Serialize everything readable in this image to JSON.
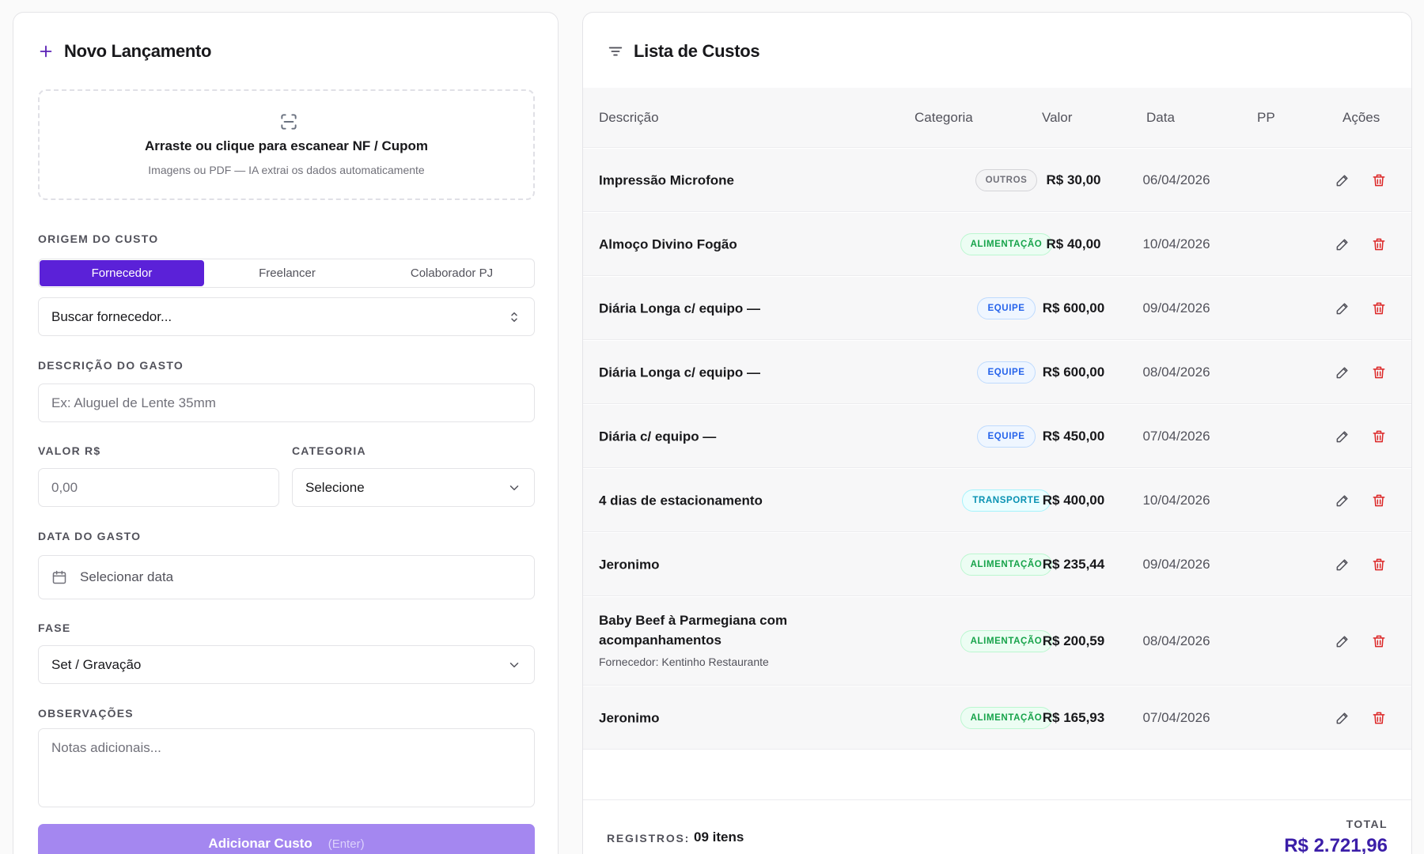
{
  "form": {
    "title": "Novo Lançamento",
    "scan": {
      "title": "Arraste ou clique para escanear NF / Cupom",
      "subtitle": "Imagens ou PDF — IA extrai os dados automaticamente"
    },
    "origin": {
      "label": "ORIGEM DO CUSTO",
      "options": [
        "Fornecedor",
        "Freelancer",
        "Colaborador PJ"
      ],
      "selected": "Fornecedor",
      "search_placeholder": "Buscar fornecedor..."
    },
    "description": {
      "label": "DESCRIÇÃO DO GASTO",
      "placeholder": "Ex: Aluguel de Lente 35mm"
    },
    "value": {
      "label": "VALOR R$",
      "placeholder": "0,00"
    },
    "category": {
      "label": "CATEGORIA",
      "value": "Selecione"
    },
    "date": {
      "label": "DATA DO GASTO",
      "placeholder": "Selecionar data"
    },
    "phase": {
      "label": "FASE",
      "value": "Set / Gravação"
    },
    "notes": {
      "label": "OBSERVAÇÕES",
      "placeholder": "Notas adicionais..."
    },
    "submit": {
      "label": "Adicionar Custo",
      "hint": "(Enter)"
    }
  },
  "costs": {
    "title": "Lista de Custos",
    "columns": {
      "description": "Descrição",
      "category": "Categoria",
      "value": "Valor",
      "date": "Data",
      "pp": "PP",
      "actions": "Ações"
    },
    "rows": [
      {
        "description": "Impressão Microfone",
        "supplier": "",
        "category": "OUTROS",
        "value": "R$ 30,00",
        "date": "06/04/2026",
        "pp": ""
      },
      {
        "description": "Almoço Divino Fogão",
        "supplier": "",
        "category": "ALIMENTAÇÃO",
        "value": "R$ 40,00",
        "date": "10/04/2026",
        "pp": ""
      },
      {
        "description": "Diária Longa c/ equipo —",
        "supplier": "",
        "category": "EQUIPE",
        "value": "R$ 600,00",
        "date": "09/04/2026",
        "pp": ""
      },
      {
        "description": "Diária Longa c/ equipo —",
        "supplier": "",
        "category": "EQUIPE",
        "value": "R$ 600,00",
        "date": "08/04/2026",
        "pp": ""
      },
      {
        "description": "Diária c/ equipo —",
        "supplier": "",
        "category": "EQUIPE",
        "value": "R$ 450,00",
        "date": "07/04/2026",
        "pp": ""
      },
      {
        "description": "4 dias de estacionamento",
        "supplier": "",
        "category": "TRANSPORTE",
        "value": "R$ 400,00",
        "date": "10/04/2026",
        "pp": ""
      },
      {
        "description": "Jeronimo",
        "supplier": "",
        "category": "ALIMENTAÇÃO",
        "value": "R$ 235,44",
        "date": "09/04/2026",
        "pp": ""
      },
      {
        "description": "Baby Beef à Parmegiana com acompanhamentos",
        "supplier": "Fornecedor: Kentinho Restaurante",
        "category": "ALIMENTAÇÃO",
        "value": "R$ 200,59",
        "date": "08/04/2026",
        "pp": ""
      },
      {
        "description": "Jeronimo",
        "supplier": "",
        "category": "ALIMENTAÇÃO",
        "value": "R$ 165,93",
        "date": "07/04/2026",
        "pp": ""
      }
    ],
    "footer": {
      "records_label": "REGISTROS:",
      "records_value": "09 itens",
      "total_label": "TOTAL",
      "total_value": "R$ 2.721,96"
    }
  },
  "badge_colors": {
    "OUTROS": {
      "fg": "#71717a",
      "bg": "#f4f4f5",
      "border": "#d4d4d8"
    },
    "ALIMENTAÇÃO": {
      "fg": "#16a34a",
      "bg": "#ecfdf3",
      "border": "#bbf7d0"
    },
    "EQUIPE": {
      "fg": "#2563eb",
      "bg": "#eff6ff",
      "border": "#bfdbfe"
    },
    "TRANSPORTE": {
      "fg": "#0891b2",
      "bg": "#ecfeff",
      "border": "#a5f3fc"
    }
  },
  "icons": {
    "form_title": "plus-icon",
    "scan": "scan-icon",
    "origin_search": "chevrons-up-down-icon",
    "category": "chevron-down-icon",
    "date": "calendar-icon",
    "phase": "chevron-down-icon",
    "list_title": "filter-icon",
    "row_edit": "pencil-icon",
    "row_delete": "trash-icon"
  },
  "colors": {
    "accent": "#5b21d8",
    "accent_disabled": "#a487f0",
    "total": "#3b1ea8",
    "danger": "#dc2626"
  }
}
